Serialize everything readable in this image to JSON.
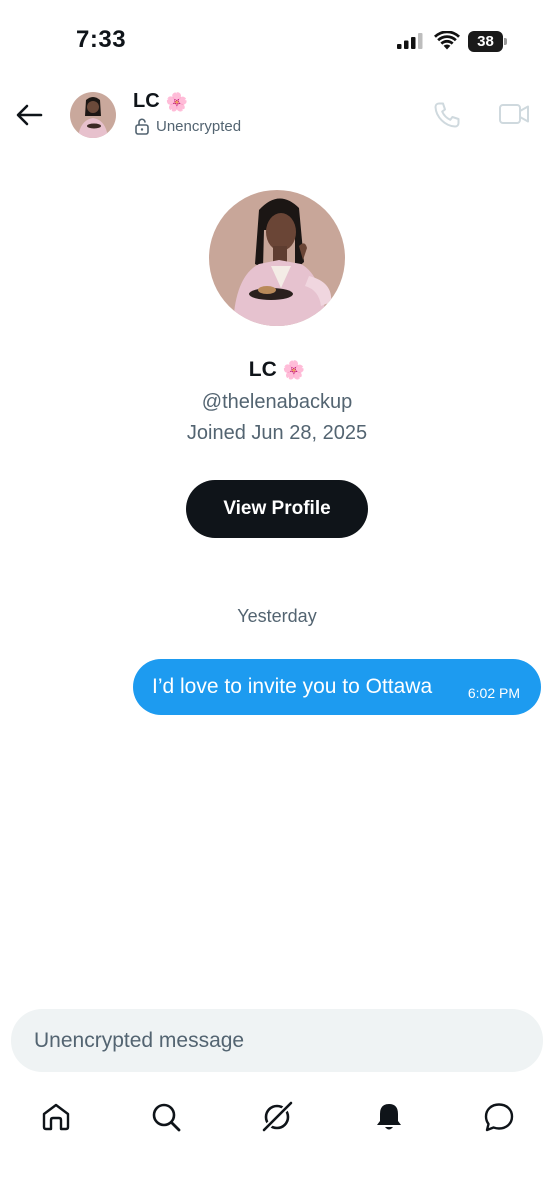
{
  "status_bar": {
    "time": "7:33",
    "battery_level": "38",
    "icons": [
      "cellular-signal-icon",
      "wifi-icon",
      "battery-icon"
    ]
  },
  "header": {
    "name": "LC",
    "name_emoji": "🌸",
    "encryption_status": "Unencrypted",
    "icons": [
      "back-arrow-icon",
      "lock-open-icon",
      "phone-icon",
      "video-icon"
    ]
  },
  "profile": {
    "name": "LC",
    "name_emoji": "🌸",
    "handle": "@thelenabackup",
    "joined": "Joined Jun 28, 2025",
    "view_profile_label": "View Profile"
  },
  "conversation": {
    "day_label": "Yesterday",
    "messages": [
      {
        "text": "I’d love to invite you to Ottawa",
        "time": "6:02 PM",
        "direction": "outgoing"
      }
    ]
  },
  "composer": {
    "placeholder": "Unencrypted message",
    "value": ""
  },
  "tabbar": {
    "tabs": [
      "home-icon",
      "search-icon",
      "grok-icon",
      "notifications-icon",
      "messages-icon"
    ]
  },
  "colors": {
    "accent": "#1d9bf0",
    "text_primary": "#0f1419",
    "text_secondary": "#536471",
    "composer_bg": "#eff3f4"
  }
}
